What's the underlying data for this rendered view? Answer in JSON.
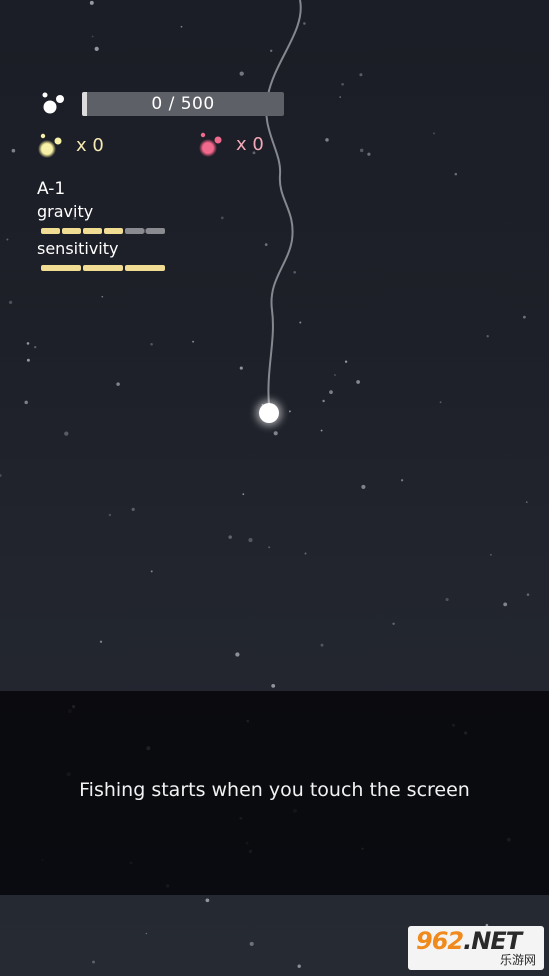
{
  "progress": {
    "text": "0 / 500",
    "current": 0,
    "max": 500
  },
  "counters": {
    "yellow": {
      "label": "x 0",
      "color": "#f4e9b4"
    },
    "pink": {
      "label": "x 0",
      "color": "#f3a9b8"
    }
  },
  "stage": {
    "name": "A-1",
    "gravity": {
      "label": "gravity",
      "level": 4,
      "max": 6
    },
    "sensitivity": {
      "label": "sensitivity",
      "level": 3,
      "max": 3
    }
  },
  "prompt": "Fishing starts when you touch the screen",
  "watermark": {
    "main": "962",
    "suffix": ".NET",
    "sub": "乐游网"
  },
  "icons": {
    "hud": "white-orbs-icon",
    "yellow": "yellow-orbs-icon",
    "pink": "pink-orbs-icon"
  }
}
